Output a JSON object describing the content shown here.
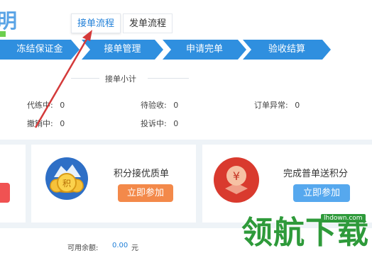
{
  "tabs": [
    {
      "label": "接单流程",
      "active": true
    },
    {
      "label": "发单流程",
      "active": false
    }
  ],
  "steps": [
    "冻结保证金",
    "接单管理",
    "申请完单",
    "验收结算"
  ],
  "summary": {
    "title": "接单小计",
    "stats": [
      {
        "label": "代练中:",
        "value": "0"
      },
      {
        "label": "待验收:",
        "value": "0"
      },
      {
        "label": "订单异常:",
        "value": "0"
      },
      {
        "label": "撤销中:",
        "value": "0"
      },
      {
        "label": "投诉中:",
        "value": "0"
      }
    ]
  },
  "cards": [
    {
      "title": "积分接优质单",
      "button": "立即参加",
      "icon": "coins-medal-icon"
    },
    {
      "title": "完成普单送积分",
      "button": "立即参加",
      "icon": "yuan-badge-icon"
    }
  ],
  "balance": {
    "label": "可用余额:",
    "value": "0.00",
    "unit": "元"
  },
  "watermark": {
    "big": "领航下载",
    "small": "lhdown.com"
  },
  "colors": {
    "accent": "#1f7fd8",
    "step": "#2f8fdf",
    "orange_button": "#f3894a",
    "blue_button": "#56a8ee",
    "watermark": "#2e9a3a",
    "arrow": "#d43a3a"
  }
}
